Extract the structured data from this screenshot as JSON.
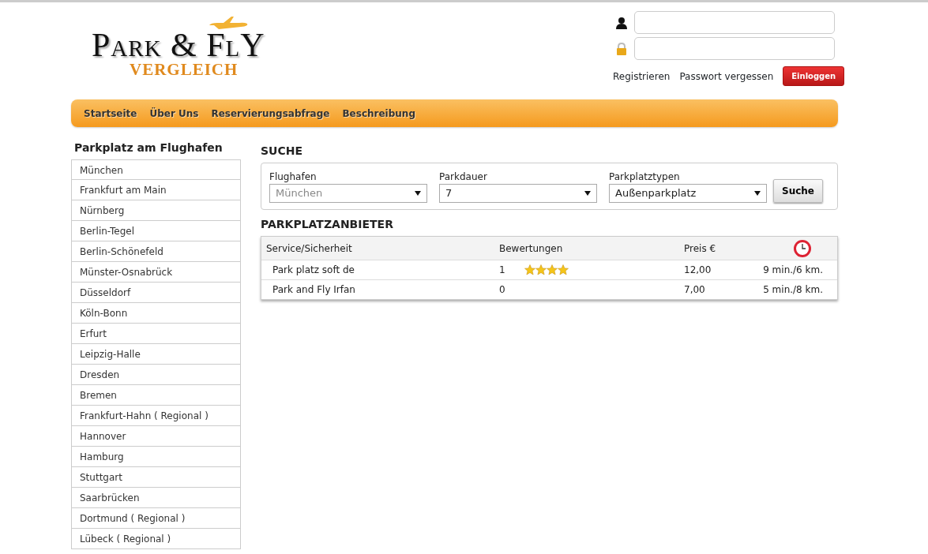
{
  "logo": {
    "title": "Park & FlY",
    "subtitle": "VERGLEICH"
  },
  "login": {
    "links": [
      "Registrieren",
      "Passwort vergessen"
    ],
    "button": "Einloggen"
  },
  "nav": [
    "Startseite",
    "Über Uns",
    "Reservierungsabfrage",
    "Beschreibung"
  ],
  "sidebar": {
    "title": "Parkplatz am Flughafen",
    "items": [
      "München",
      "Frankfurt am Main",
      "Nürnberg",
      "Berlin-Tegel",
      "Berlin-Schönefeld",
      "Münster-Osnabrück",
      "Düsseldorf",
      "Köln-Bonn",
      "Erfurt",
      "Leipzig-Halle",
      "Dresden",
      "Bremen",
      "Frankfurt-Hahn ( Regional )",
      "Hannover",
      "Hamburg",
      "Stuttgart",
      "Saarbrücken",
      "Dortmund ( Regional )",
      "Lübeck ( Regional )"
    ]
  },
  "search": {
    "title": "SUCHE",
    "fields": [
      {
        "label": "Flughafen",
        "placeholder": "München"
      },
      {
        "label": "Parkdauer",
        "value": "7"
      },
      {
        "label": "Parkplatztypen",
        "value": "Außenparkplatz"
      }
    ],
    "button": "Suche"
  },
  "providers": {
    "title": "PARKPLATZANBIETER",
    "columns": [
      "Service/Sicherheit",
      "Bewertungen",
      "Preis €"
    ],
    "rows": [
      {
        "name": "Park platz soft de",
        "reviews": "1",
        "stars": 4,
        "price": "12,00",
        "distance": "9 min./6 km."
      },
      {
        "name": "Park and Fly Irfan",
        "reviews": "0",
        "price": "7,00",
        "distance": "5 min./8 km."
      }
    ]
  }
}
